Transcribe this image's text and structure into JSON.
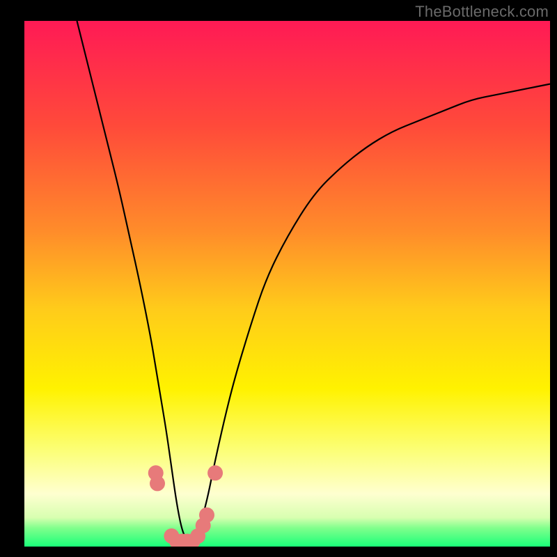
{
  "watermark": "TheBottleneck.com",
  "chart_data": {
    "type": "line",
    "title": "",
    "xlabel": "",
    "ylabel": "",
    "xlim": [
      0,
      100
    ],
    "ylim": [
      0,
      100
    ],
    "gradient_stops": [
      {
        "offset": 0.0,
        "color": "#ff1a55"
      },
      {
        "offset": 0.2,
        "color": "#ff4a3a"
      },
      {
        "offset": 0.4,
        "color": "#ff8c2a"
      },
      {
        "offset": 0.55,
        "color": "#ffcc1a"
      },
      {
        "offset": 0.7,
        "color": "#fff200"
      },
      {
        "offset": 0.82,
        "color": "#fcff7a"
      },
      {
        "offset": 0.9,
        "color": "#feffd0"
      },
      {
        "offset": 0.945,
        "color": "#d8ffb0"
      },
      {
        "offset": 0.965,
        "color": "#7fff8c"
      },
      {
        "offset": 1.0,
        "color": "#1aff79"
      }
    ],
    "series": [
      {
        "name": "bottleneck-curve",
        "x": [
          10,
          12,
          14,
          16,
          18,
          20,
          22,
          24,
          25,
          26,
          27,
          28,
          29,
          30,
          31,
          32,
          33,
          34,
          35,
          36,
          38,
          40,
          43,
          46,
          50,
          55,
          60,
          65,
          70,
          75,
          80,
          85,
          90,
          95,
          100
        ],
        "y": [
          100,
          92,
          84,
          76,
          68,
          59,
          50,
          40,
          34,
          28,
          22,
          15,
          8,
          3,
          1,
          1,
          2,
          6,
          10,
          15,
          24,
          32,
          42,
          51,
          59,
          67,
          72,
          76,
          79,
          81,
          83,
          85,
          86,
          87,
          88
        ]
      }
    ],
    "markers": {
      "name": "highlight-points",
      "color": "#e77a7a",
      "points": [
        {
          "x": 25.0,
          "y": 14
        },
        {
          "x": 25.3,
          "y": 12
        },
        {
          "x": 28.0,
          "y": 2
        },
        {
          "x": 29.0,
          "y": 1
        },
        {
          "x": 30.0,
          "y": 1
        },
        {
          "x": 31.0,
          "y": 1
        },
        {
          "x": 32.0,
          "y": 1
        },
        {
          "x": 33.0,
          "y": 2
        },
        {
          "x": 34.0,
          "y": 4
        },
        {
          "x": 34.7,
          "y": 6
        },
        {
          "x": 36.3,
          "y": 14
        }
      ]
    }
  }
}
